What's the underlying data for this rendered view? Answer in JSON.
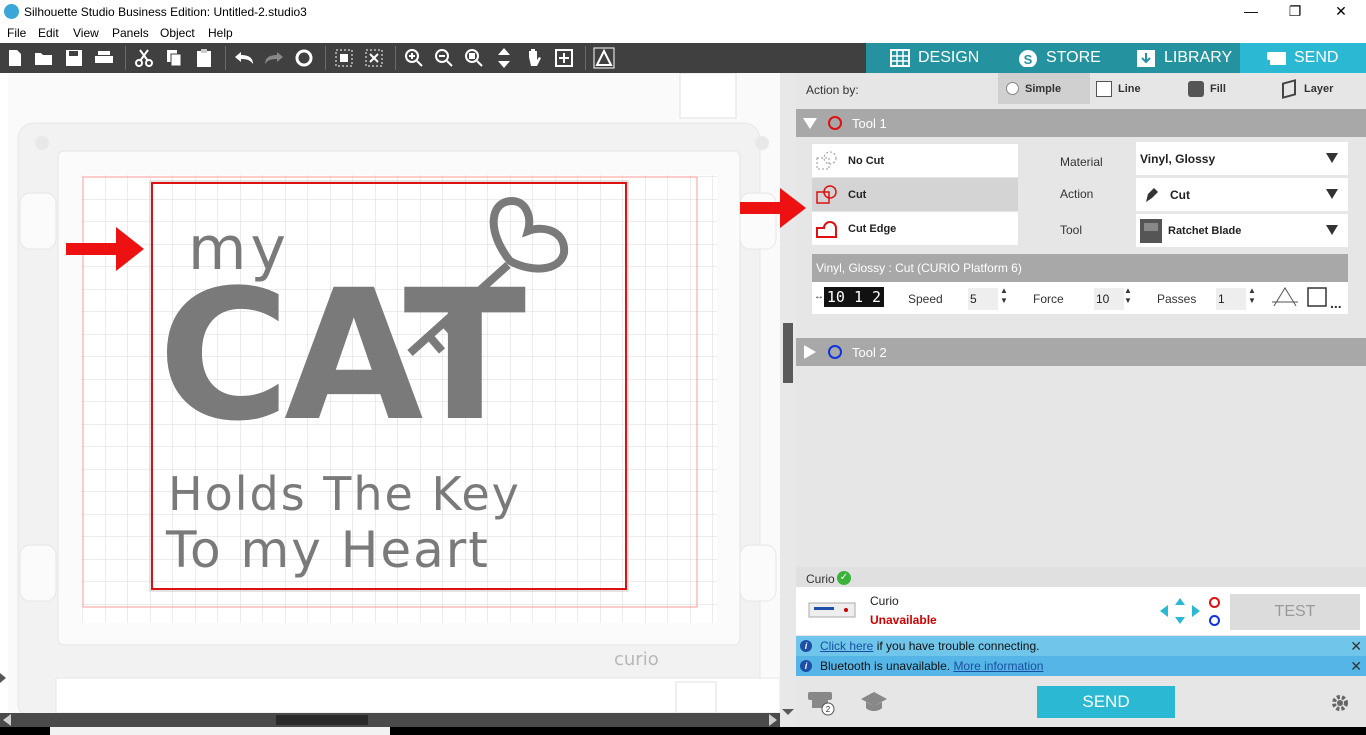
{
  "window": {
    "title": "Silhouette Studio Business Edition: Untitled-2.studio3",
    "minimize": "—",
    "maximize": "❐",
    "close": "✕"
  },
  "menu": [
    "File",
    "Edit",
    "View",
    "Panels",
    "Object",
    "Help"
  ],
  "nav_tabs": [
    {
      "label": "DESIGN",
      "icon": "grid-icon"
    },
    {
      "label": "STORE",
      "icon": "silhouette-s-icon"
    },
    {
      "label": "LIBRARY",
      "icon": "library-download-icon"
    },
    {
      "label": "SEND",
      "icon": "cutter-icon"
    }
  ],
  "action_by": {
    "label": "Action by:",
    "options": [
      "Simple",
      "Line",
      "Fill",
      "Layer"
    ],
    "selected": "Simple"
  },
  "tool1": {
    "label": "Tool 1",
    "color": "#dd1111",
    "options": [
      "No Cut",
      "Cut",
      "Cut Edge"
    ],
    "selected": "Cut",
    "fields": {
      "material_label": "Material",
      "material_value": "Vinyl, Glossy",
      "action_label": "Action",
      "action_value": "Cut",
      "tool_label": "Tool",
      "tool_value": "Ratchet Blade"
    },
    "settings_title": "Vinyl, Glossy : Cut (CURIO Platform 6)",
    "blade_readout": "10 1 2",
    "speed_label": "Speed",
    "speed_value": "5",
    "force_label": "Force",
    "force_value": "10",
    "passes_label": "Passes",
    "passes_value": "1",
    "more": "..."
  },
  "tool2": {
    "label": "Tool 2",
    "color": "#1133dd"
  },
  "device": {
    "name_header": "Curio",
    "name": "Curio",
    "status": "Unavailable",
    "test_label": "TEST"
  },
  "banners": [
    {
      "link": "Click here",
      "text": " if you have trouble connecting."
    },
    {
      "text": "Bluetooth is unavailable. ",
      "link": "More information"
    }
  ],
  "send_label": "SEND",
  "design": {
    "line1": "my",
    "line2": "CAT",
    "line3": "Holds The Key",
    "line4": "To my Heart",
    "mat_brand": "curio",
    "design_color": "#7a7a7a"
  },
  "colors": {
    "accent": "#2ab8d3",
    "tab_bg": "#25939f",
    "toolbar": "#404040",
    "cut_red": "#dd1111"
  }
}
